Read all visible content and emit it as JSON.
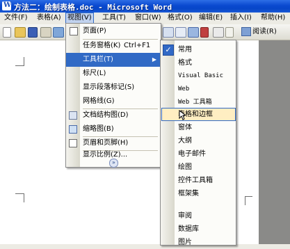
{
  "window": {
    "title": "方法二：绘制表格.doc - Microsoft Word"
  },
  "menubar": {
    "items": [
      "文件(F)",
      "表格(A)",
      "视图(V)",
      "工具(T)",
      "窗口(W)",
      "格式(O)",
      "编辑(E)",
      "插入(I)",
      "帮助(H)"
    ],
    "active": "视图(V)"
  },
  "toolbar": {
    "read_label": "阅读(R)"
  },
  "view_menu": {
    "items": [
      {
        "label": "页面(P)",
        "shortcut": ""
      },
      {
        "label": "任务窗格(K)",
        "shortcut": "Ctrl+F1"
      },
      {
        "label": "工具栏(T)",
        "shortcut": ""
      },
      {
        "label": "标尺(L)",
        "shortcut": ""
      },
      {
        "label": "显示段落标记(S)",
        "shortcut": ""
      },
      {
        "label": "网格线(G)",
        "shortcut": ""
      },
      {
        "label": "文档结构图(D)",
        "shortcut": ""
      },
      {
        "label": "缩略图(B)",
        "shortcut": ""
      },
      {
        "label": "页眉和页脚(H)",
        "shortcut": ""
      },
      {
        "label": "显示比例(Z)...",
        "shortcut": ""
      }
    ],
    "highlighted": "工具栏(T)",
    "expand_glyph": "»"
  },
  "toolbars_submenu": {
    "items": [
      "常用",
      "格式",
      "Visual Basic",
      "Web",
      "Web 工具箱",
      "表格和边框",
      "窗体",
      "大纲",
      "电子邮件",
      "绘图",
      "控件工具箱",
      "框架集",
      "审阅",
      "数据库",
      "图片"
    ],
    "checked": "常用",
    "hovered": "表格和边框"
  }
}
